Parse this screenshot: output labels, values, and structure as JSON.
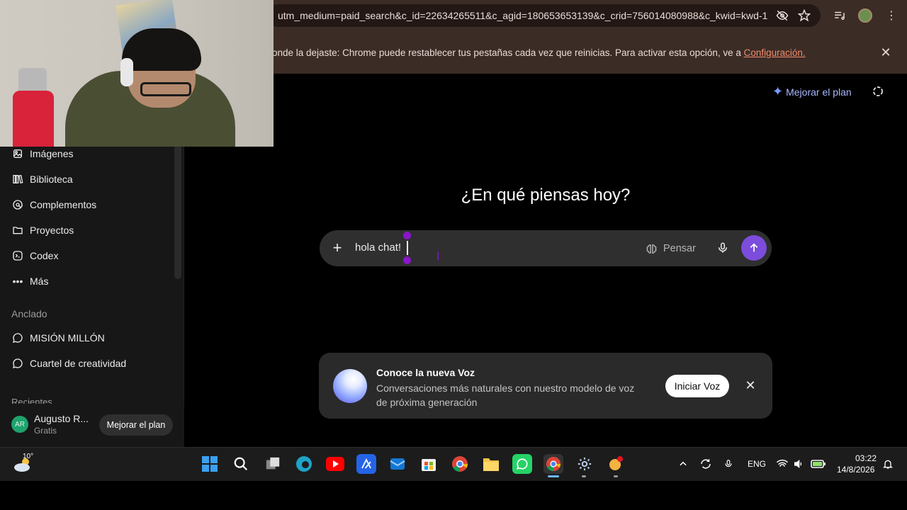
{
  "browser": {
    "url": "utm_medium=paid_search&c_id=22634265511&c_agid=180653653139&c_crid=756014080988&c_kwid=kwd-1...",
    "infobar_text": "onde la dejaste: Chrome puede restablecer tus pestañas cada vez que reinicias. Para activar esta opción, ve a ",
    "infobar_link": "Configuración.",
    "icons": [
      "eye-off-icon",
      "star-icon",
      "media-icon",
      "profile-avatar",
      "menu-icon",
      "close-icon"
    ]
  },
  "sidebar": {
    "items": [
      {
        "label": "Imágenes",
        "icon": "images-icon"
      },
      {
        "label": "Biblioteca",
        "icon": "library-icon"
      },
      {
        "label": "Complementos",
        "icon": "plugins-icon"
      },
      {
        "label": "Proyectos",
        "icon": "folder-icon"
      },
      {
        "label": "Codex",
        "icon": "codex-icon"
      },
      {
        "label": "Más",
        "icon": "more-icon"
      }
    ],
    "pinned_label": "Anclado",
    "pinned": [
      {
        "label": "MISIÓN MILLÓN",
        "icon": "chat-bubble-icon"
      },
      {
        "label": "Cuartel de creatividad",
        "icon": "chat-bubble-icon"
      }
    ],
    "recent_label": "Recientes",
    "user": {
      "initials": "AR",
      "name": "Augusto R...",
      "plan": "Gratis"
    },
    "footer_upgrade": "Mejorar el plan"
  },
  "header": {
    "upgrade": "Mejorar el plan"
  },
  "main": {
    "headline": "¿En qué piensas hoy?",
    "composer_value": "hola chat!",
    "think_label": "Pensar"
  },
  "voice_card": {
    "title": "Conoce la nueva Voz",
    "description": "Conversaciones más naturales con nuestro modelo de voz de próxima generación",
    "start_label": "Iniciar Voz"
  },
  "taskbar": {
    "temperature": "10°",
    "language": "ENG",
    "time": "03:22",
    "date": "14/8/2026"
  },
  "colors": {
    "accent_send": "#7c4ddc",
    "upgrade_link": "#a9b8ff",
    "infobar_bg": "#3c2c26",
    "infobar_link": "#f28b6b"
  }
}
